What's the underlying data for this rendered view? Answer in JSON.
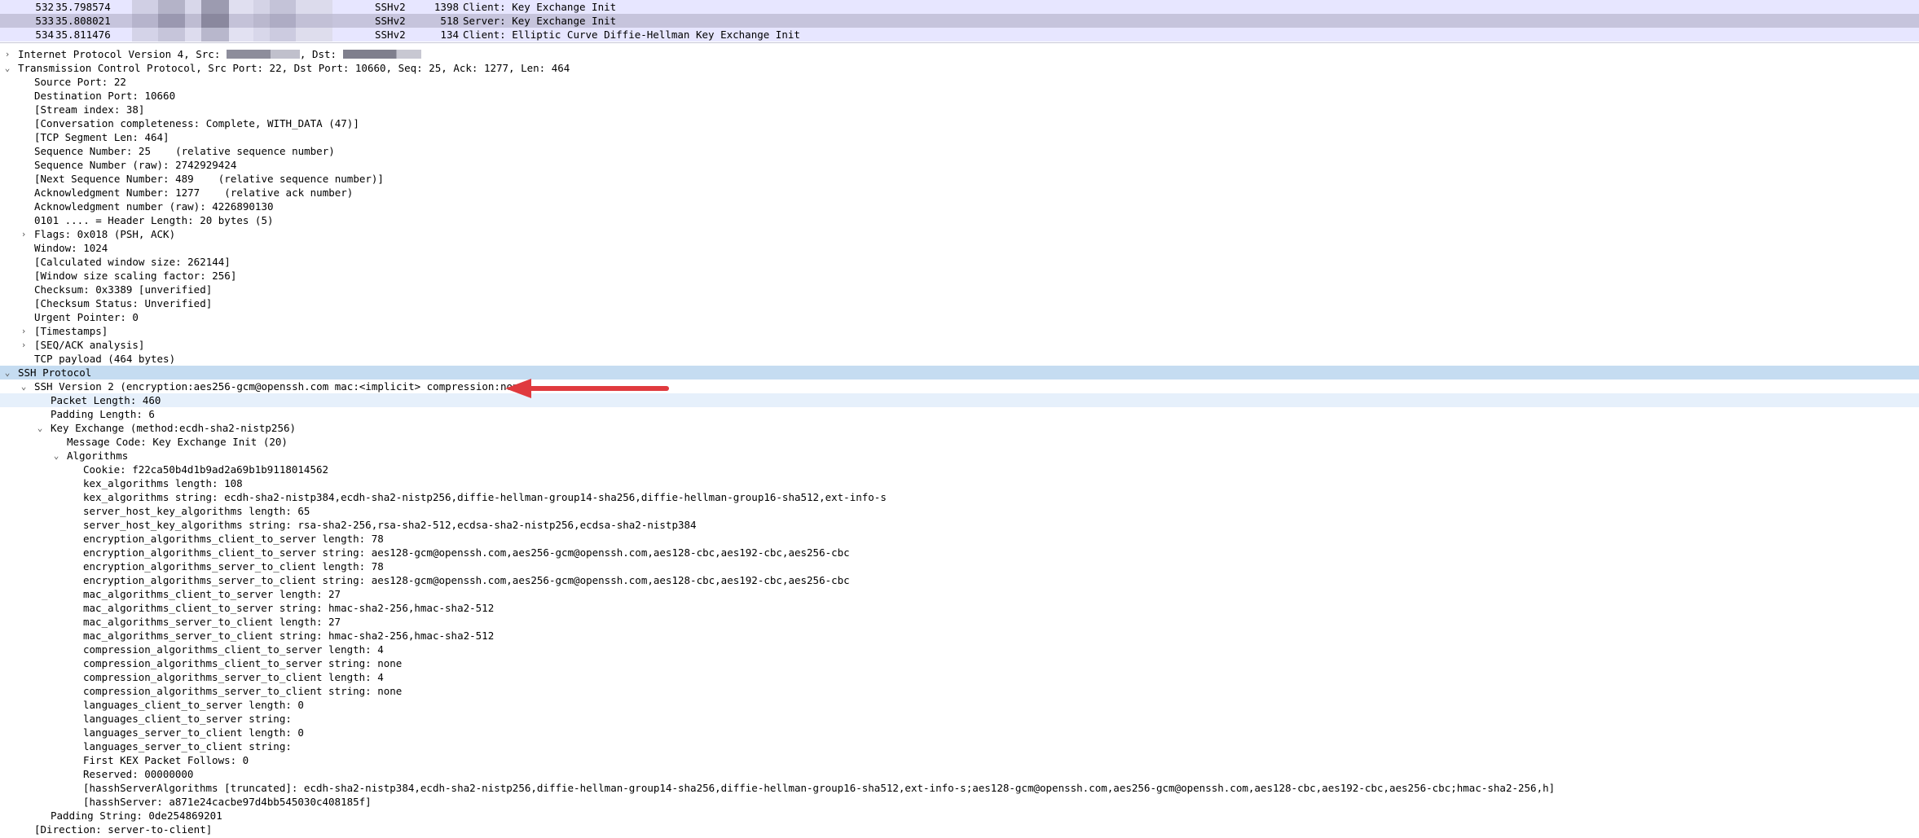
{
  "colors": {
    "row_bg": "#e7e6ff",
    "row_selected_bg": "#c6c4dc",
    "section_highlight": "#c5dcf1",
    "field_highlight": "#e6f0fb",
    "arrow": "#e03a3e",
    "redaction_light": "#dcdcec",
    "redaction_dark": "#8d8d9b"
  },
  "packets": [
    {
      "no": "532",
      "time": "35.798574",
      "protocol": "SSHv2",
      "length": "1398",
      "info": "Client: Key Exchange Init"
    },
    {
      "no": "533",
      "time": "35.808021",
      "protocol": "SSHv2",
      "length": "518",
      "info": "Server: Key Exchange Init"
    },
    {
      "no": "534",
      "time": "35.811476",
      "protocol": "SSHv2",
      "length": "134",
      "info": "Client: Elliptic Curve Diffie-Hellman Key Exchange Init"
    }
  ],
  "ip_row": {
    "prefix": "Internet Protocol Version 4, Src:",
    "dst": ", Dst:"
  },
  "tree": [
    {
      "text": "Transmission Control Protocol, Src Port: 22, Dst Port: 10660, Seq: 25, Ack: 1277, Len: 464",
      "toggle": "expanded"
    },
    {
      "text": "Source Port: 22"
    },
    {
      "text": "Destination Port: 10660"
    },
    {
      "text": "[Stream index: 38]"
    },
    {
      "text": "[Conversation completeness: Complete, WITH_DATA (47)]"
    },
    {
      "text": "[TCP Segment Len: 464]"
    },
    {
      "text": "Sequence Number: 25    (relative sequence number)"
    },
    {
      "text": "Sequence Number (raw): 2742929424"
    },
    {
      "text": "[Next Sequence Number: 489    (relative sequence number)]"
    },
    {
      "text": "Acknowledgment Number: 1277    (relative ack number)"
    },
    {
      "text": "Acknowledgment number (raw): 4226890130"
    },
    {
      "text": "0101 .... = Header Length: 20 bytes (5)"
    },
    {
      "text": "Flags: 0x018 (PSH, ACK)",
      "toggle": "collapsed"
    },
    {
      "text": "Window: 1024"
    },
    {
      "text": "[Calculated window size: 262144]"
    },
    {
      "text": "[Window size scaling factor: 256]"
    },
    {
      "text": "Checksum: 0x3389 [unverified]"
    },
    {
      "text": "[Checksum Status: Unverified]"
    },
    {
      "text": "Urgent Pointer: 0"
    },
    {
      "text": "[Timestamps]",
      "toggle": "collapsed"
    },
    {
      "text": "[SEQ/ACK analysis]",
      "toggle": "collapsed"
    },
    {
      "text": "TCP payload (464 bytes)"
    },
    {
      "text": "SSH Protocol",
      "toggle": "expanded",
      "highlight": "section"
    },
    {
      "text": "SSH Version 2 (encryption:aes256-gcm@openssh.com mac:<implicit> compression:none)",
      "toggle": "expanded"
    },
    {
      "text": "Packet Length: 460",
      "highlight": "field"
    },
    {
      "text": "Padding Length: 6"
    },
    {
      "text": "Key Exchange (method:ecdh-sha2-nistp256)",
      "toggle": "expanded"
    },
    {
      "text": "Message Code: Key Exchange Init (20)"
    },
    {
      "text": "Algorithms",
      "toggle": "expanded"
    },
    {
      "text": "Cookie: f22ca50b4d1b9ad2a69b1b9118014562"
    },
    {
      "text": "kex_algorithms length: 108"
    },
    {
      "text": "kex_algorithms string: ecdh-sha2-nistp384,ecdh-sha2-nistp256,diffie-hellman-group14-sha256,diffie-hellman-group16-sha512,ext-info-s"
    },
    {
      "text": "server_host_key_algorithms length: 65"
    },
    {
      "text": "server_host_key_algorithms string: rsa-sha2-256,rsa-sha2-512,ecdsa-sha2-nistp256,ecdsa-sha2-nistp384"
    },
    {
      "text": "encryption_algorithms_client_to_server length: 78"
    },
    {
      "text": "encryption_algorithms_client_to_server string: aes128-gcm@openssh.com,aes256-gcm@openssh.com,aes128-cbc,aes192-cbc,aes256-cbc"
    },
    {
      "text": "encryption_algorithms_server_to_client length: 78"
    },
    {
      "text": "encryption_algorithms_server_to_client string: aes128-gcm@openssh.com,aes256-gcm@openssh.com,aes128-cbc,aes192-cbc,aes256-cbc"
    },
    {
      "text": "mac_algorithms_client_to_server length: 27"
    },
    {
      "text": "mac_algorithms_client_to_server string: hmac-sha2-256,hmac-sha2-512"
    },
    {
      "text": "mac_algorithms_server_to_client length: 27"
    },
    {
      "text": "mac_algorithms_server_to_client string: hmac-sha2-256,hmac-sha2-512"
    },
    {
      "text": "compression_algorithms_client_to_server length: 4"
    },
    {
      "text": "compression_algorithms_client_to_server string: none"
    },
    {
      "text": "compression_algorithms_server_to_client length: 4"
    },
    {
      "text": "compression_algorithms_server_to_client string: none"
    },
    {
      "text": "languages_client_to_server length: 0"
    },
    {
      "text": "languages_client_to_server string:"
    },
    {
      "text": "languages_server_to_client length: 0"
    },
    {
      "text": "languages_server_to_client string:"
    },
    {
      "text": "First KEX Packet Follows: 0"
    },
    {
      "text": "Reserved: 00000000"
    },
    {
      "text": "[hasshServerAlgorithms [truncated]: ecdh-sha2-nistp384,ecdh-sha2-nistp256,diffie-hellman-group14-sha256,diffie-hellman-group16-sha512,ext-info-s;aes128-gcm@openssh.com,aes256-gcm@openssh.com,aes128-cbc,aes192-cbc,aes256-cbc;hmac-sha2-256,h]"
    },
    {
      "text": "[hasshServer: a871e24cacbe97d4bb545030c408185f]"
    },
    {
      "text": "Padding String: 0de254869201"
    },
    {
      "text": "[Direction: server-to-client]"
    }
  ]
}
